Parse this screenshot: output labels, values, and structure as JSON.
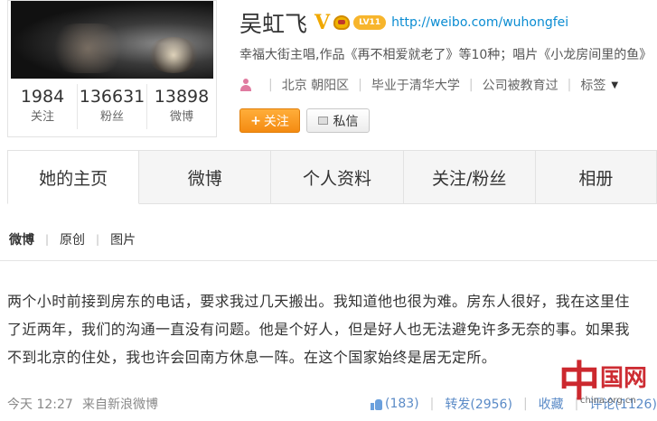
{
  "profile": {
    "name": "吴虹飞",
    "verified_mark": "V",
    "level_badge": "LV11",
    "homepage_url": "http://weibo.com/wuhongfei",
    "bio": "幸福大街主唱,作品《再不相爱就老了》等10种；唱片《小龙房间里的鱼》",
    "location": "北京 朝阳区",
    "education": "毕业于清华大学",
    "company": "公司被教育过",
    "tags_label": "标签",
    "follow_label": "关注",
    "message_label": "私信",
    "stats": [
      {
        "num": "1984",
        "label": "关注"
      },
      {
        "num": "136631",
        "label": "粉丝"
      },
      {
        "num": "13898",
        "label": "微博"
      }
    ]
  },
  "tabs": [
    "她的主页",
    "微博",
    "个人资料",
    "关注/粉丝",
    "相册"
  ],
  "subtabs": [
    "微博",
    "原创",
    "图片"
  ],
  "post": {
    "text": "两个小时前接到房东的电话，要求我过几天搬出。我知道他也很为难。房东人很好，我在这里住了近两年，我们的沟通一直没有问题。他是个好人，但是好人也无法避免许多无奈的事。如果我不到北京的住处，我也许会回南方休息一阵。在这个国家始终是居无定所。",
    "time": "今天 12:27",
    "source": "来自新浪微博",
    "likes": "(183)",
    "repost": "转发(2956)",
    "favorite": "收藏",
    "comment": "评论(1126)"
  },
  "watermark": {
    "char": "中",
    "word": "国网",
    "url": "china.org.cn"
  },
  "colors": {
    "link": "#0a8cd2",
    "follow_button": "#f48b12",
    "action_link": "#5b8bc7",
    "watermark": "#c8161d"
  },
  "icons": [
    "crown-icon",
    "person-icon",
    "message-icon",
    "thumb-up-icon",
    "chevron-down-icon"
  ]
}
